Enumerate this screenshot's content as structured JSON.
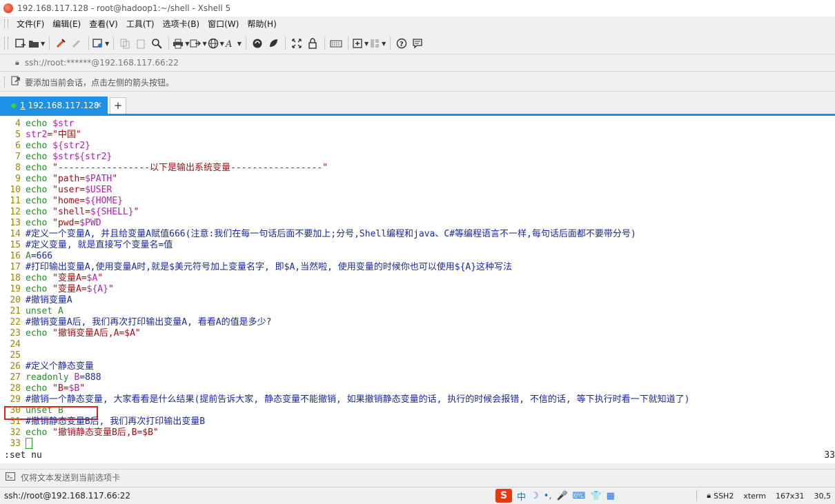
{
  "window": {
    "title": "192.168.117.128 - root@hadoop1:~/shell - Xshell 5"
  },
  "menu": [
    "文件(F)",
    "编辑(E)",
    "查看(V)",
    "工具(T)",
    "选项卡(B)",
    "窗口(W)",
    "帮助(H)"
  ],
  "toolbar": {
    "icons": [
      "new-session-icon",
      "open-folder-icon",
      "reconnect-icon",
      "disconnect-icon",
      "properties-icon",
      "copy-icon",
      "paste-icon",
      "find-icon",
      "print-icon",
      "transfer-icon",
      "globe-icon",
      "font-icon",
      "xftp-icon",
      "script-icon",
      "fullscreen-icon",
      "lock-icon",
      "keyboard-icon",
      "add-tab-icon",
      "layout-icon",
      "help-icon",
      "chat-icon"
    ]
  },
  "address": {
    "text": "ssh://root:******@192.168.117.66:22"
  },
  "hint": {
    "text": "要添加当前会话，点击左侧的箭头按钮。"
  },
  "tab": {
    "number": "1",
    "label": " 192.168.117.128",
    "close": "×",
    "add": "+"
  },
  "terminal": {
    "lines": [
      {
        "n": "4",
        "parts": [
          [
            "kw",
            "echo "
          ],
          [
            "var",
            "$str"
          ]
        ]
      },
      {
        "n": "5",
        "parts": [
          [
            "var",
            "str2"
          ],
          [
            "str",
            "=\"中国\""
          ]
        ]
      },
      {
        "n": "6",
        "parts": [
          [
            "kw",
            "echo "
          ],
          [
            "var",
            "${str2}"
          ]
        ]
      },
      {
        "n": "7",
        "parts": [
          [
            "kw",
            "echo "
          ],
          [
            "var",
            "$str${str2}"
          ]
        ]
      },
      {
        "n": "8",
        "parts": [
          [
            "kw",
            "echo "
          ],
          [
            "str",
            "\"-----------------以下是输出系统变量-----------------\""
          ]
        ]
      },
      {
        "n": "9",
        "parts": [
          [
            "kw",
            "echo "
          ],
          [
            "str",
            "\"path="
          ],
          [
            "var",
            "$PATH"
          ],
          [
            "str",
            "\""
          ]
        ]
      },
      {
        "n": "10",
        "parts": [
          [
            "kw",
            "echo "
          ],
          [
            "str",
            "\"user="
          ],
          [
            "var",
            "$USER"
          ]
        ]
      },
      {
        "n": "11",
        "parts": [
          [
            "kw",
            "echo "
          ],
          [
            "str",
            "\"home="
          ],
          [
            "var",
            "${HOME}"
          ]
        ]
      },
      {
        "n": "12",
        "parts": [
          [
            "kw",
            "echo "
          ],
          [
            "str",
            "\"shell="
          ],
          [
            "var",
            "${SHELL}"
          ],
          [
            "str",
            "\""
          ]
        ]
      },
      {
        "n": "13",
        "parts": [
          [
            "kw",
            "echo "
          ],
          [
            "str",
            "\"pwd="
          ],
          [
            "var",
            "$PWD"
          ]
        ]
      },
      {
        "n": "14",
        "parts": [
          [
            "cmt",
            "#定义一个变量A, 并且给变量A赋值666(注意:我们在每一句话后面不要加上;分号,Shell编程和java、C#等编程语言不一样,每句话后面都不要带分号)"
          ]
        ]
      },
      {
        "n": "15",
        "parts": [
          [
            "cmt",
            "#定义变量, 就是直接写个变量名=值"
          ]
        ]
      },
      {
        "n": "16",
        "parts": [
          [
            "kw",
            "A"
          ],
          [
            "plain",
            "=666"
          ]
        ]
      },
      {
        "n": "17",
        "parts": [
          [
            "cmt",
            "#打印输出变量A,使用变量A时,就是$美元符号加上变量名字, 即$A,当然啦, 使用变量的时候你也可以使用${A}这种写法"
          ]
        ]
      },
      {
        "n": "18",
        "parts": [
          [
            "kw",
            "echo "
          ],
          [
            "str",
            "\"变量A="
          ],
          [
            "var",
            "$A"
          ],
          [
            "str",
            "\""
          ]
        ]
      },
      {
        "n": "19",
        "parts": [
          [
            "kw",
            "echo "
          ],
          [
            "str",
            "\"变量A="
          ],
          [
            "var",
            "${A}"
          ],
          [
            "str",
            "\""
          ]
        ]
      },
      {
        "n": "20",
        "parts": [
          [
            "cmt",
            "#撤销变量A"
          ]
        ]
      },
      {
        "n": "21",
        "parts": [
          [
            "kw",
            "unset A"
          ]
        ]
      },
      {
        "n": "22",
        "parts": [
          [
            "cmt",
            "#撤销变量A后, 我们再次打印输出变量A, 看看A的值是多少?"
          ]
        ]
      },
      {
        "n": "23",
        "parts": [
          [
            "kw",
            "echo "
          ],
          [
            "str",
            "\"撤销变量A后,A=$A\""
          ]
        ]
      },
      {
        "n": "24",
        "parts": []
      },
      {
        "n": "25",
        "parts": []
      },
      {
        "n": "26",
        "parts": [
          [
            "cmt",
            "#定义个静态变量"
          ]
        ]
      },
      {
        "n": "27",
        "parts": [
          [
            "kw",
            "readonly "
          ],
          [
            "var",
            "B"
          ],
          [
            "plain",
            "=888"
          ]
        ]
      },
      {
        "n": "28",
        "parts": [
          [
            "kw",
            "echo "
          ],
          [
            "str",
            "\"B="
          ],
          [
            "var",
            "$B"
          ],
          [
            "str",
            "\""
          ]
        ]
      },
      {
        "n": "29",
        "parts": [
          [
            "cmt",
            "#撤销一个静态变量, 大家看看是什么结果(提前告诉大家, 静态变量不能撤销, 如果撤销静态变量的话, 执行的时候会报错, 不信的话, 等下执行时看一下就知道了)"
          ]
        ]
      },
      {
        "n": "30",
        "parts": [
          [
            "kw",
            "unset B"
          ]
        ]
      },
      {
        "n": "31",
        "parts": [
          [
            "cmt",
            "#撤销静态变量B后, 我们再次打印输出变量B"
          ]
        ]
      },
      {
        "n": "32",
        "parts": [
          [
            "kw",
            "echo "
          ],
          [
            "str",
            "\"撤销静态变量B后,B=$B\""
          ]
        ]
      },
      {
        "n": "33",
        "parts": [
          [
            "cursor",
            ""
          ]
        ]
      }
    ],
    "command": ":set nu",
    "position_right": "33"
  },
  "sendbar": {
    "text": "仅将文本发送到当前选项卡"
  },
  "status": {
    "connection": "ssh://root@192.168.117.66:22",
    "ime_logo": "S",
    "ime_items": [
      "中",
      "☽",
      "•,",
      "🎤",
      "⌨",
      "👕",
      "▦"
    ],
    "protocol": "SSH2",
    "term": "xterm",
    "size": "167x31",
    "cursor_pos": "30,5"
  },
  "colors": {
    "accent": "#1e90e6",
    "highlight_box": "#e02020"
  }
}
